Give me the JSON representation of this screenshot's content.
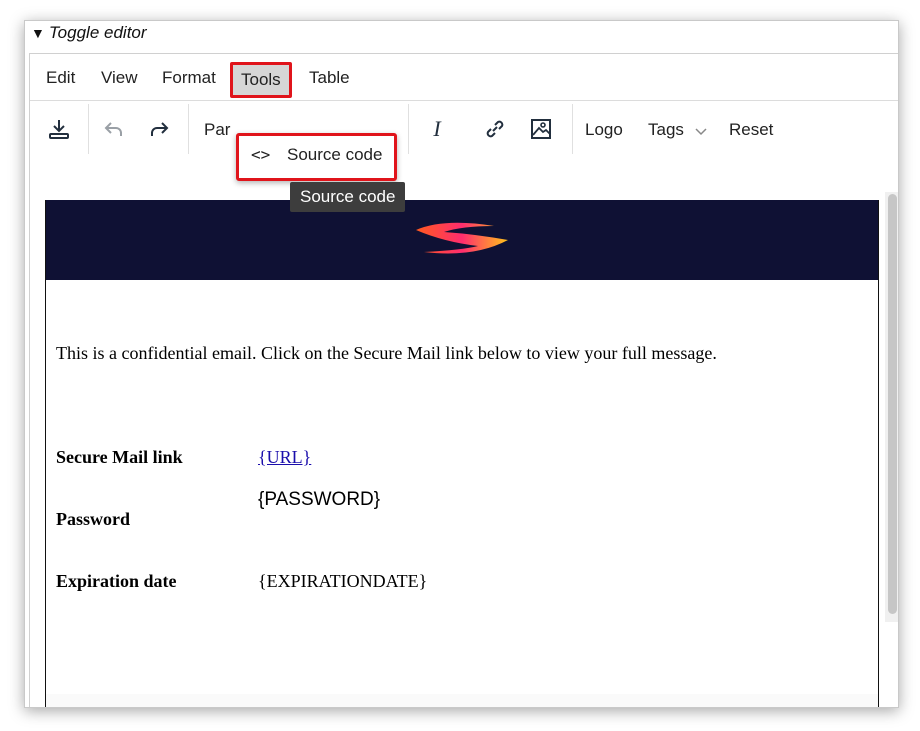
{
  "toggle": {
    "label": "Toggle editor"
  },
  "menubar": {
    "items": [
      {
        "label": "Edit"
      },
      {
        "label": "View"
      },
      {
        "label": "Format"
      },
      {
        "label": "Tools",
        "active": true
      },
      {
        "label": "Table"
      }
    ]
  },
  "toolbar": {
    "block_format_partial": "Par",
    "logo_label": "Logo",
    "tags_label": "Tags",
    "reset_label": "Reset"
  },
  "dropdown": {
    "source_code_label": "Source code"
  },
  "tooltip": {
    "text": "Source code"
  },
  "email": {
    "intro": "This is a confidential email. Click on the Secure Mail link below to view your full message.",
    "secure_link_label": "Secure Mail link",
    "secure_link_value": "{URL}",
    "password_label": "Password",
    "password_value": "{PASSWORD}",
    "expiration_label": "Expiration date",
    "expiration_value": "{EXPIRATIONDATE}"
  },
  "colors": {
    "highlight": "#e0141b",
    "banner": "#0f1134",
    "link": "#1a0dab"
  }
}
